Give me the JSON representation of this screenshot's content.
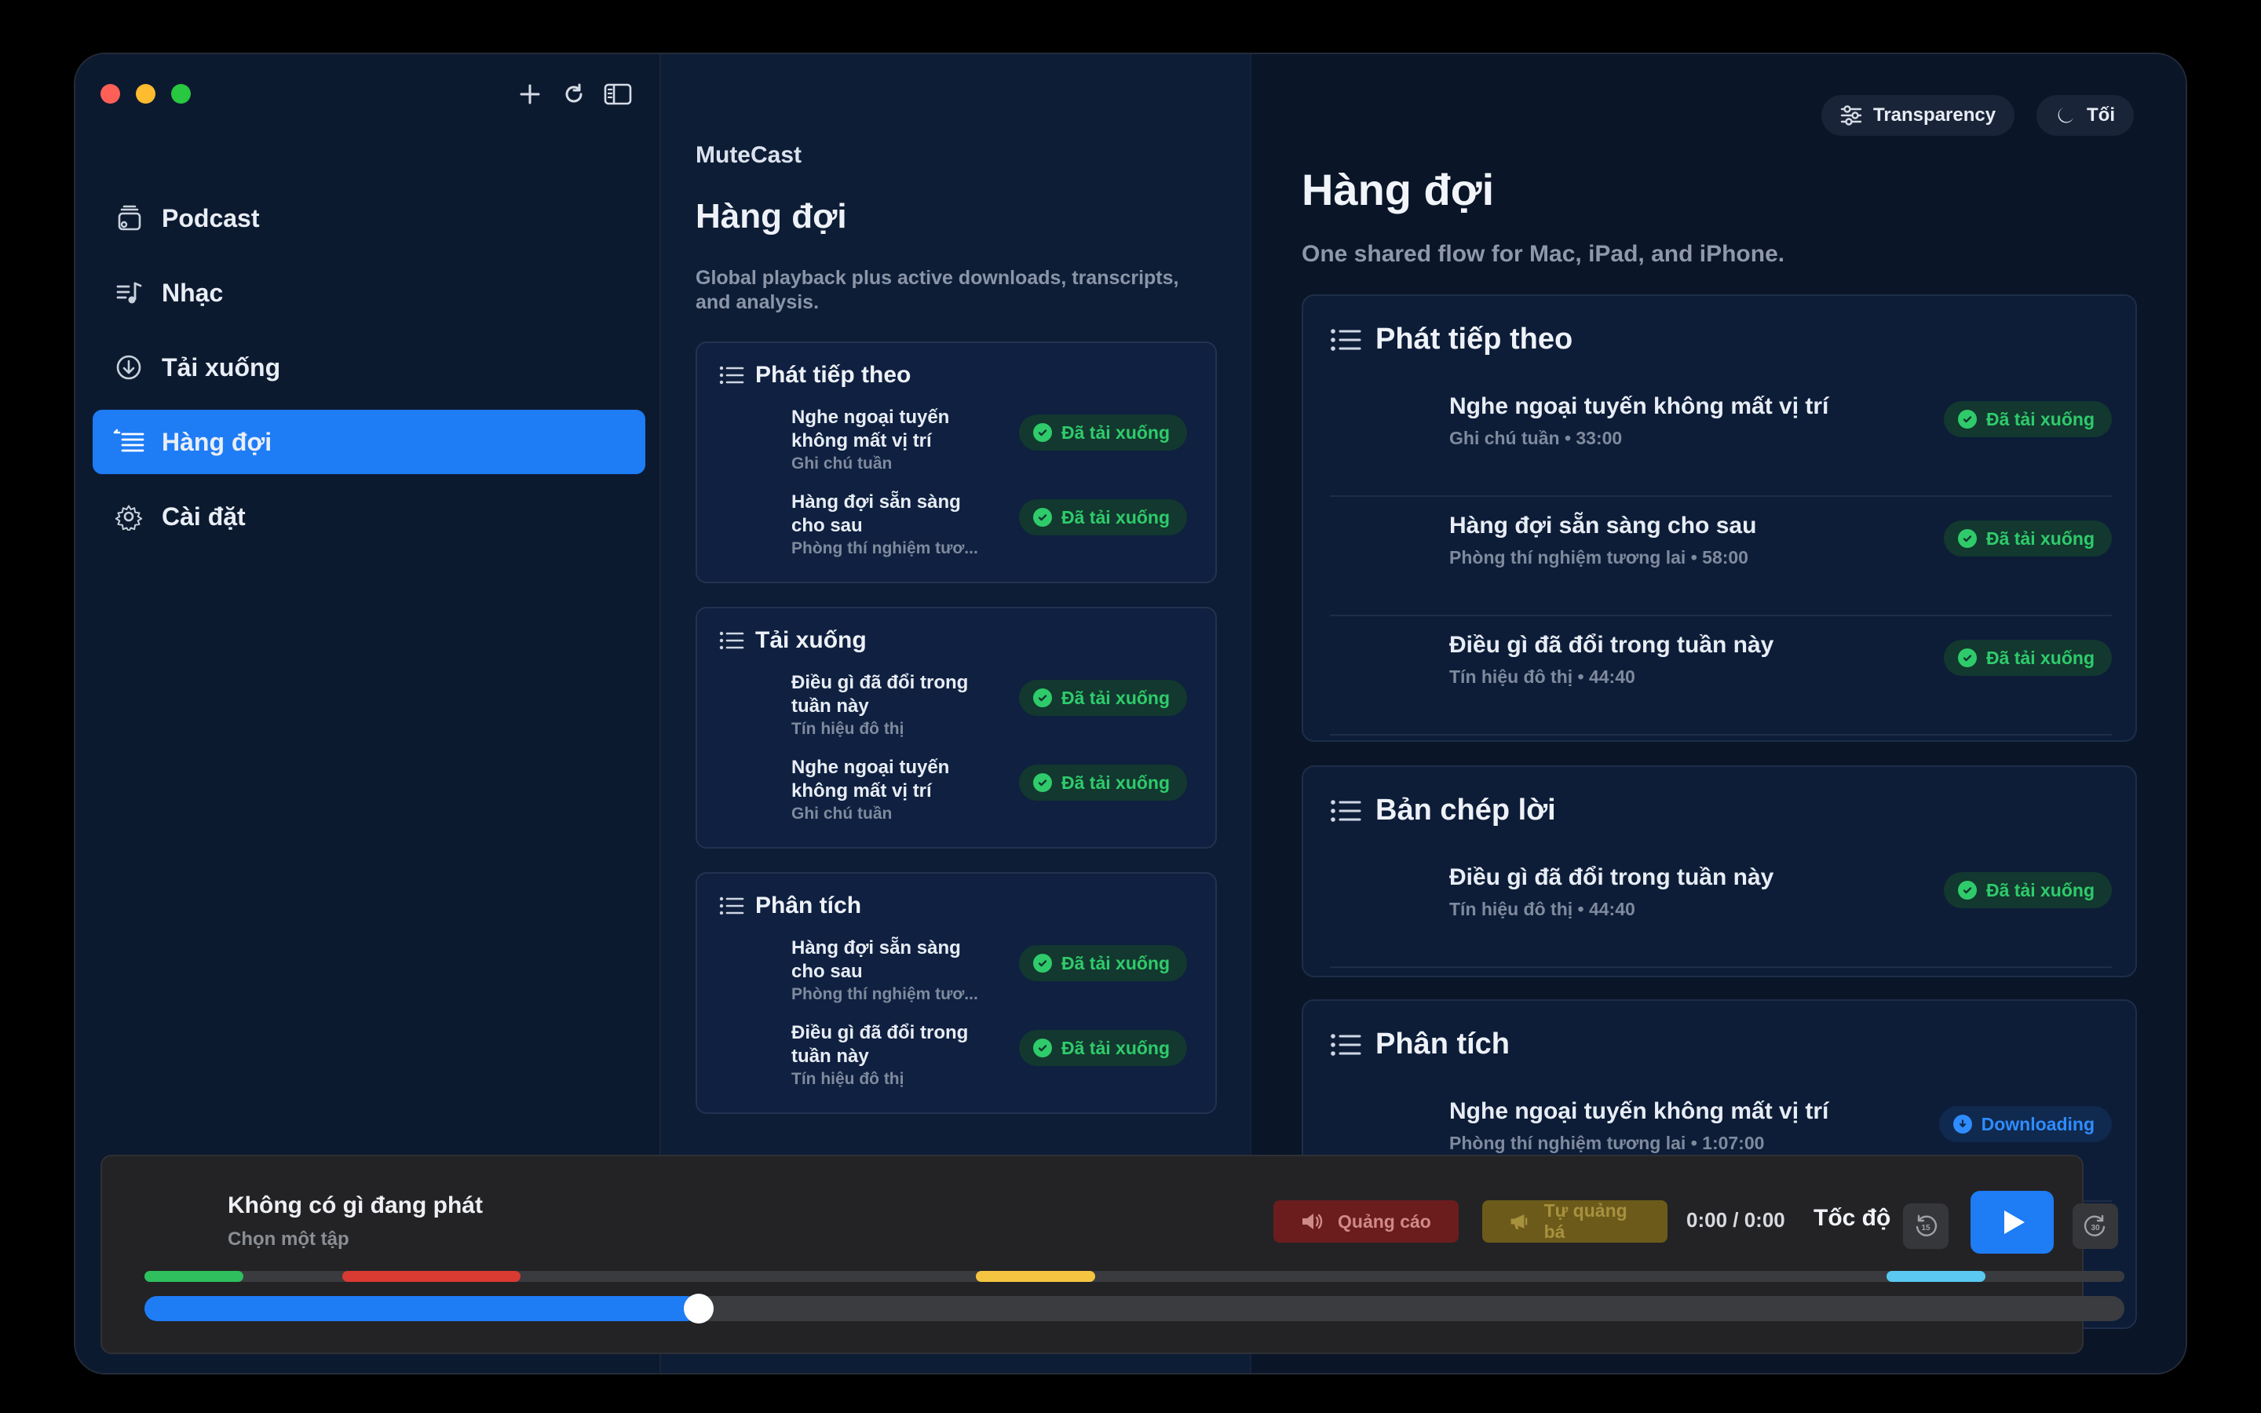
{
  "sidebar": {
    "items": [
      {
        "label": "Podcast",
        "icon": "podcast-stack-icon"
      },
      {
        "label": "Nhạc",
        "icon": "music-list-icon"
      },
      {
        "label": "Tải xuống",
        "icon": "download-circle-icon"
      },
      {
        "label": "Hàng đợi",
        "icon": "queue-list-icon",
        "active": true
      },
      {
        "label": "Cài đặt",
        "icon": "gear-icon"
      }
    ]
  },
  "middle": {
    "app_name": "MuteCast",
    "title": "Hàng đợi",
    "description": "Global playback plus active downloads, transcripts, and analysis.",
    "cards": [
      {
        "title": "Phát tiếp theo",
        "rows": [
          {
            "title": "Nghe ngoại tuyến không mất vị trí",
            "subtitle": "Ghi chú tuần",
            "badge": "Đã tải xuống"
          },
          {
            "title": "Hàng đợi sẵn sàng cho sau",
            "subtitle": "Phòng thí nghiệm tươ...",
            "badge": "Đã tải xuống"
          }
        ]
      },
      {
        "title": "Tải xuống",
        "rows": [
          {
            "title": "Điều gì đã đổi trong tuần này",
            "subtitle": "Tín hiệu đô thị",
            "badge": "Đã tải xuống"
          },
          {
            "title": "Nghe ngoại tuyến không mất vị trí",
            "subtitle": "Ghi chú tuần",
            "badge": "Đã tải xuống"
          }
        ]
      },
      {
        "title": "Phân tích",
        "rows": [
          {
            "title": "Hàng đợi sẵn sàng cho sau",
            "subtitle": "Phòng thí nghiệm tươ...",
            "badge": "Đã tải xuống"
          },
          {
            "title": "Điều gì đã đổi trong tuần này",
            "subtitle": "Tín hiệu đô thị",
            "badge": "Đã tải xuống"
          }
        ]
      }
    ]
  },
  "right": {
    "transparency_label": "Transparency",
    "theme_label": "Tối",
    "title": "Hàng đợi",
    "description": "One shared flow for Mac, iPad, and iPhone.",
    "cards": [
      {
        "title": "Phát tiếp theo",
        "rows": [
          {
            "title": "Nghe ngoại tuyến không mất vị trí",
            "subtitle": "Ghi chú tuần • 33:00",
            "badge": "Đã tải xuống"
          },
          {
            "title": "Hàng đợi sẵn sàng cho sau",
            "subtitle": "Phòng thí nghiệm tương lai • 58:00",
            "badge": "Đã tải xuống"
          },
          {
            "title": "Điều gì đã đổi trong tuần này",
            "subtitle": "Tín hiệu đô thị • 44:40",
            "badge": "Đã tải xuống"
          }
        ]
      },
      {
        "title": "Bản chép lời",
        "rows": [
          {
            "title": "Điều gì đã đổi trong tuần này",
            "subtitle": "Tín hiệu đô thị • 44:40",
            "badge": "Đã tải xuống"
          }
        ]
      },
      {
        "title": "Phân tích",
        "rows": [
          {
            "title": "Nghe ngoại tuyến không mất vị trí",
            "subtitle": "Phòng thí nghiệm tương lai • 1:07:00",
            "badge": "Downloading",
            "badge_state": "downloading"
          }
        ]
      }
    ]
  },
  "player": {
    "title": "Không có gì đang phát",
    "subtitle": "Chọn một tập",
    "ad_label": "Quảng cáo",
    "promo_label": "Tự quảng bá",
    "time": "0:00 / 0:00",
    "speed_label": "Tốc độ",
    "skip_back_seconds": "15",
    "skip_forward_seconds": "30",
    "progress_fraction": 0.28,
    "segments": [
      {
        "kind": "green",
        "start": 0.0,
        "end": 0.05,
        "color": "#2fbf5e"
      },
      {
        "kind": "red",
        "start": 0.1,
        "end": 0.19,
        "color": "#d93a32"
      },
      {
        "kind": "yellow",
        "start": 0.42,
        "end": 0.48,
        "color": "#f5c542"
      },
      {
        "kind": "cyan",
        "start": 0.88,
        "end": 0.93,
        "color": "#5ac8f0"
      }
    ]
  },
  "colors": {
    "accent": "#1e7cf5",
    "downloaded_green": "#2fcb6b",
    "downloading_blue": "#2f8cff"
  }
}
